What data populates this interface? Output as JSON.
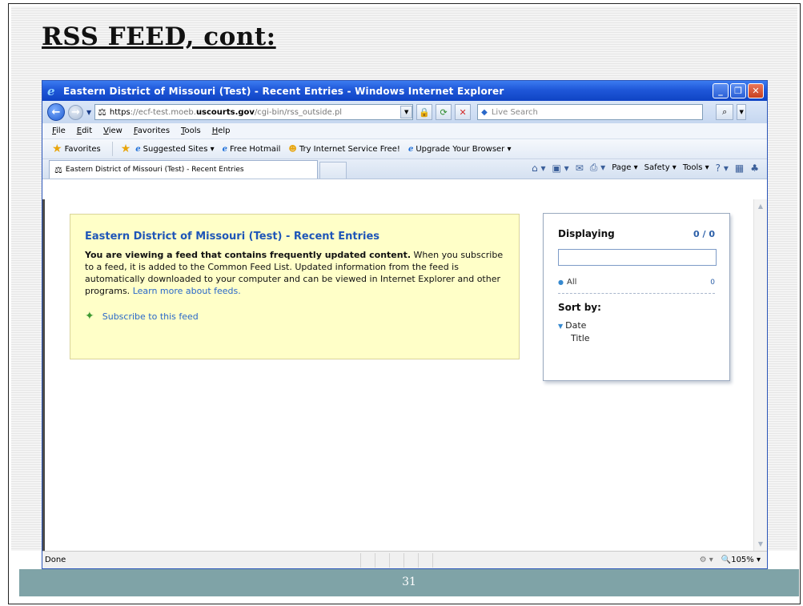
{
  "slide": {
    "title": "RSS FEED, cont:",
    "page_number": "31"
  },
  "browser": {
    "window_title": "Eastern District of Missouri (Test) - Recent Entries - Windows Internet Explorer",
    "address": {
      "protocol": "https",
      "prefix": "://ecf-test.moeb.",
      "domain": "uscourts.gov",
      "path": "/cgi-bin/rss_outside.pl"
    },
    "search_placeholder": "Live Search",
    "menu": [
      "File",
      "Edit",
      "View",
      "Favorites",
      "Tools",
      "Help"
    ],
    "favorites_bar": {
      "favorites_label": "Favorites",
      "items": [
        "Suggested Sites ▾",
        "Free Hotmail",
        "Try Internet Service Free!",
        "Upgrade Your Browser ▾"
      ]
    },
    "tab_label": "Eastern District of Missouri (Test) - Recent Entries",
    "command_bar": {
      "page": "Page ▾",
      "safety": "Safety ▾",
      "tools": "Tools ▾"
    },
    "status": {
      "text": "Done",
      "zoom": "105%"
    }
  },
  "feed": {
    "title": "Eastern District of Missouri (Test) - Recent Entries",
    "bold_intro": "You are viewing a feed that contains frequently updated content.",
    "description": " When you subscribe to a feed, it is added to the Common Feed List. Updated information from the feed is automatically downloaded to your computer and can be viewed in Internet Explorer and other programs. ",
    "learn_more": "Learn more about feeds.",
    "subscribe": "Subscribe to this feed"
  },
  "panel": {
    "displaying_label": "Displaying",
    "displaying_count": "0 / 0",
    "all_label": "All",
    "all_count": "0",
    "sort_by": "Sort by:",
    "sort_options": [
      "Date",
      "Title"
    ]
  },
  "colors": {
    "titlebar": "#1f57d9",
    "feed_box": "#ffffc8",
    "link": "#2a68c9",
    "footer": "#7fa3a7"
  }
}
